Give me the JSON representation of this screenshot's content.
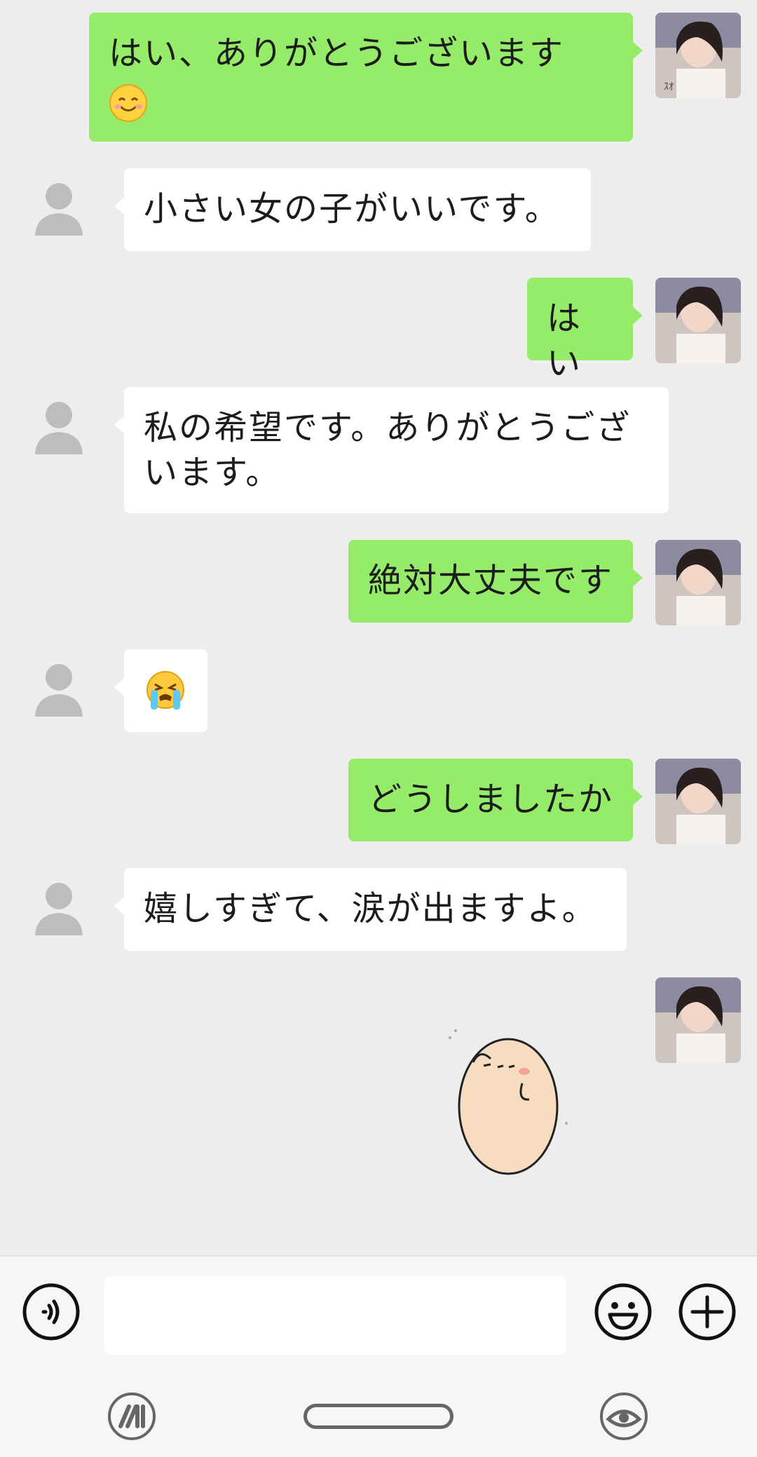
{
  "messages": [
    {
      "side": "me",
      "text": "はい、ありがとうございます",
      "emoji": "smiling-face-icon"
    },
    {
      "side": "other",
      "text": "小さい女の子がいいです。"
    },
    {
      "side": "me",
      "text": "はい"
    },
    {
      "side": "other",
      "text": "私の希望です。ありがとうござ",
      "text2": "います。"
    },
    {
      "side": "me",
      "text": "絶対大丈夫です"
    },
    {
      "side": "other",
      "emoji": "loudly-crying-face-icon"
    },
    {
      "side": "me",
      "text": "どうしましたか"
    },
    {
      "side": "other",
      "text": "嬉しすぎて、涙が出ますよ。"
    },
    {
      "side": "me",
      "sticker": "potato-character-sticker"
    }
  ],
  "input": {
    "value": "",
    "placeholder": ""
  },
  "icons": {
    "voice": "voice-icon",
    "emoji": "emoji-icon",
    "plus": "plus-icon",
    "avatar_other": "default-user-icon",
    "avatar_me": "profile-photo"
  },
  "colors": {
    "background": "#ededed",
    "my_bubble": "#95ec69",
    "their_bubble": "#ffffff"
  }
}
